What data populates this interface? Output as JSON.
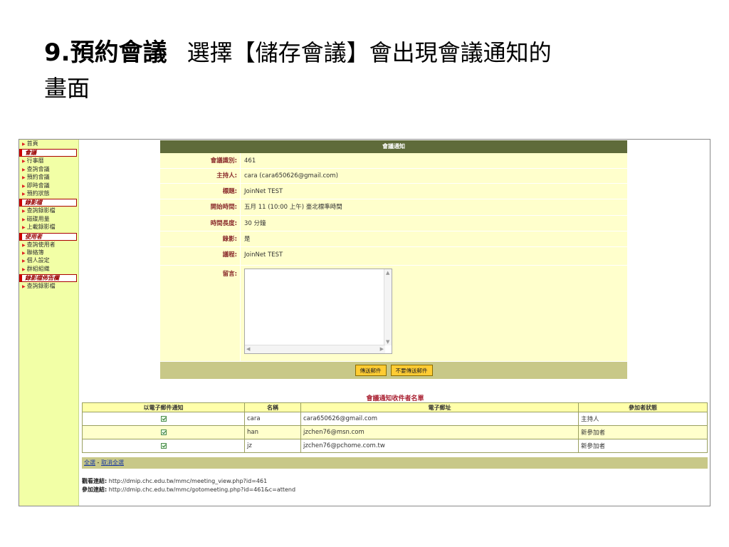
{
  "slide": {
    "title_bold": "9.預約會議",
    "title_rest": "選擇【儲存會議】會出現會議通知的",
    "title_line2": "畫面"
  },
  "sidebar": {
    "items": [
      {
        "label": "首頁",
        "type": "link"
      },
      {
        "label": "會議",
        "type": "section"
      },
      {
        "label": "行事曆",
        "type": "link"
      },
      {
        "label": "查詢會議",
        "type": "link"
      },
      {
        "label": "預約會議",
        "type": "link"
      },
      {
        "label": "即時會議",
        "type": "link"
      },
      {
        "label": "預約狀態",
        "type": "link"
      },
      {
        "label": "錄影檔",
        "type": "section"
      },
      {
        "label": "查詢錄影檔",
        "type": "link"
      },
      {
        "label": "磁碟用量",
        "type": "link"
      },
      {
        "label": "上載錄影檔",
        "type": "link"
      },
      {
        "label": "使用者",
        "type": "section"
      },
      {
        "label": "查詢使用者",
        "type": "link"
      },
      {
        "label": "聯絡簿",
        "type": "link"
      },
      {
        "label": "個人設定",
        "type": "link"
      },
      {
        "label": "群組組織",
        "type": "link"
      },
      {
        "label": "錄影檔佈告欄",
        "type": "section"
      },
      {
        "label": "查詢錄影檔",
        "type": "link"
      }
    ]
  },
  "notice": {
    "header": "會議通知",
    "fields": {
      "id": {
        "label": "會議識別:",
        "value": "461"
      },
      "host": {
        "label": "主持人:",
        "value": "cara  (cara650626@gmail.com)"
      },
      "subject": {
        "label": "標題:",
        "value": "JoinNet TEST"
      },
      "start": {
        "label": "開始時間:",
        "value": "五月 11 (10:00 上午) 臺北標準時間"
      },
      "duration": {
        "label": "時間長度:",
        "value": "30 分鐘"
      },
      "record": {
        "label": "錄影:",
        "value": "是"
      },
      "agenda": {
        "label": "議程:",
        "value": "JoinNet TEST"
      },
      "message": {
        "label": "留言:",
        "value": ""
      }
    },
    "buttons": {
      "send": "傳送郵件",
      "no_send": "不要傳送郵件"
    }
  },
  "recipients": {
    "title": "會議通知收件者名單",
    "headers": [
      "以電子郵件通知",
      "名稱",
      "電子郵址",
      "參加者狀態"
    ],
    "rows": [
      {
        "checked": true,
        "name": "cara",
        "email": "cara650626@gmail.com",
        "status": "主持人"
      },
      {
        "checked": true,
        "name": "han",
        "email": "jzchen76@msn.com",
        "status": "新參加者"
      },
      {
        "checked": true,
        "name": "jz",
        "email": "jzchen76@pchome.com.tw",
        "status": "新參加者"
      }
    ],
    "select_all": "全選",
    "separator": "-",
    "deselect_all": "取消全選"
  },
  "links": {
    "view_label": "觀看連結:",
    "view_url": "http://dmip.chc.edu.tw/mmc/meeting_view.php?id=461",
    "join_label": "參加連結:",
    "join_url": "http://dmip.chc.edu.tw/mmc/gotomeeting.php?id=461&c=attend"
  }
}
